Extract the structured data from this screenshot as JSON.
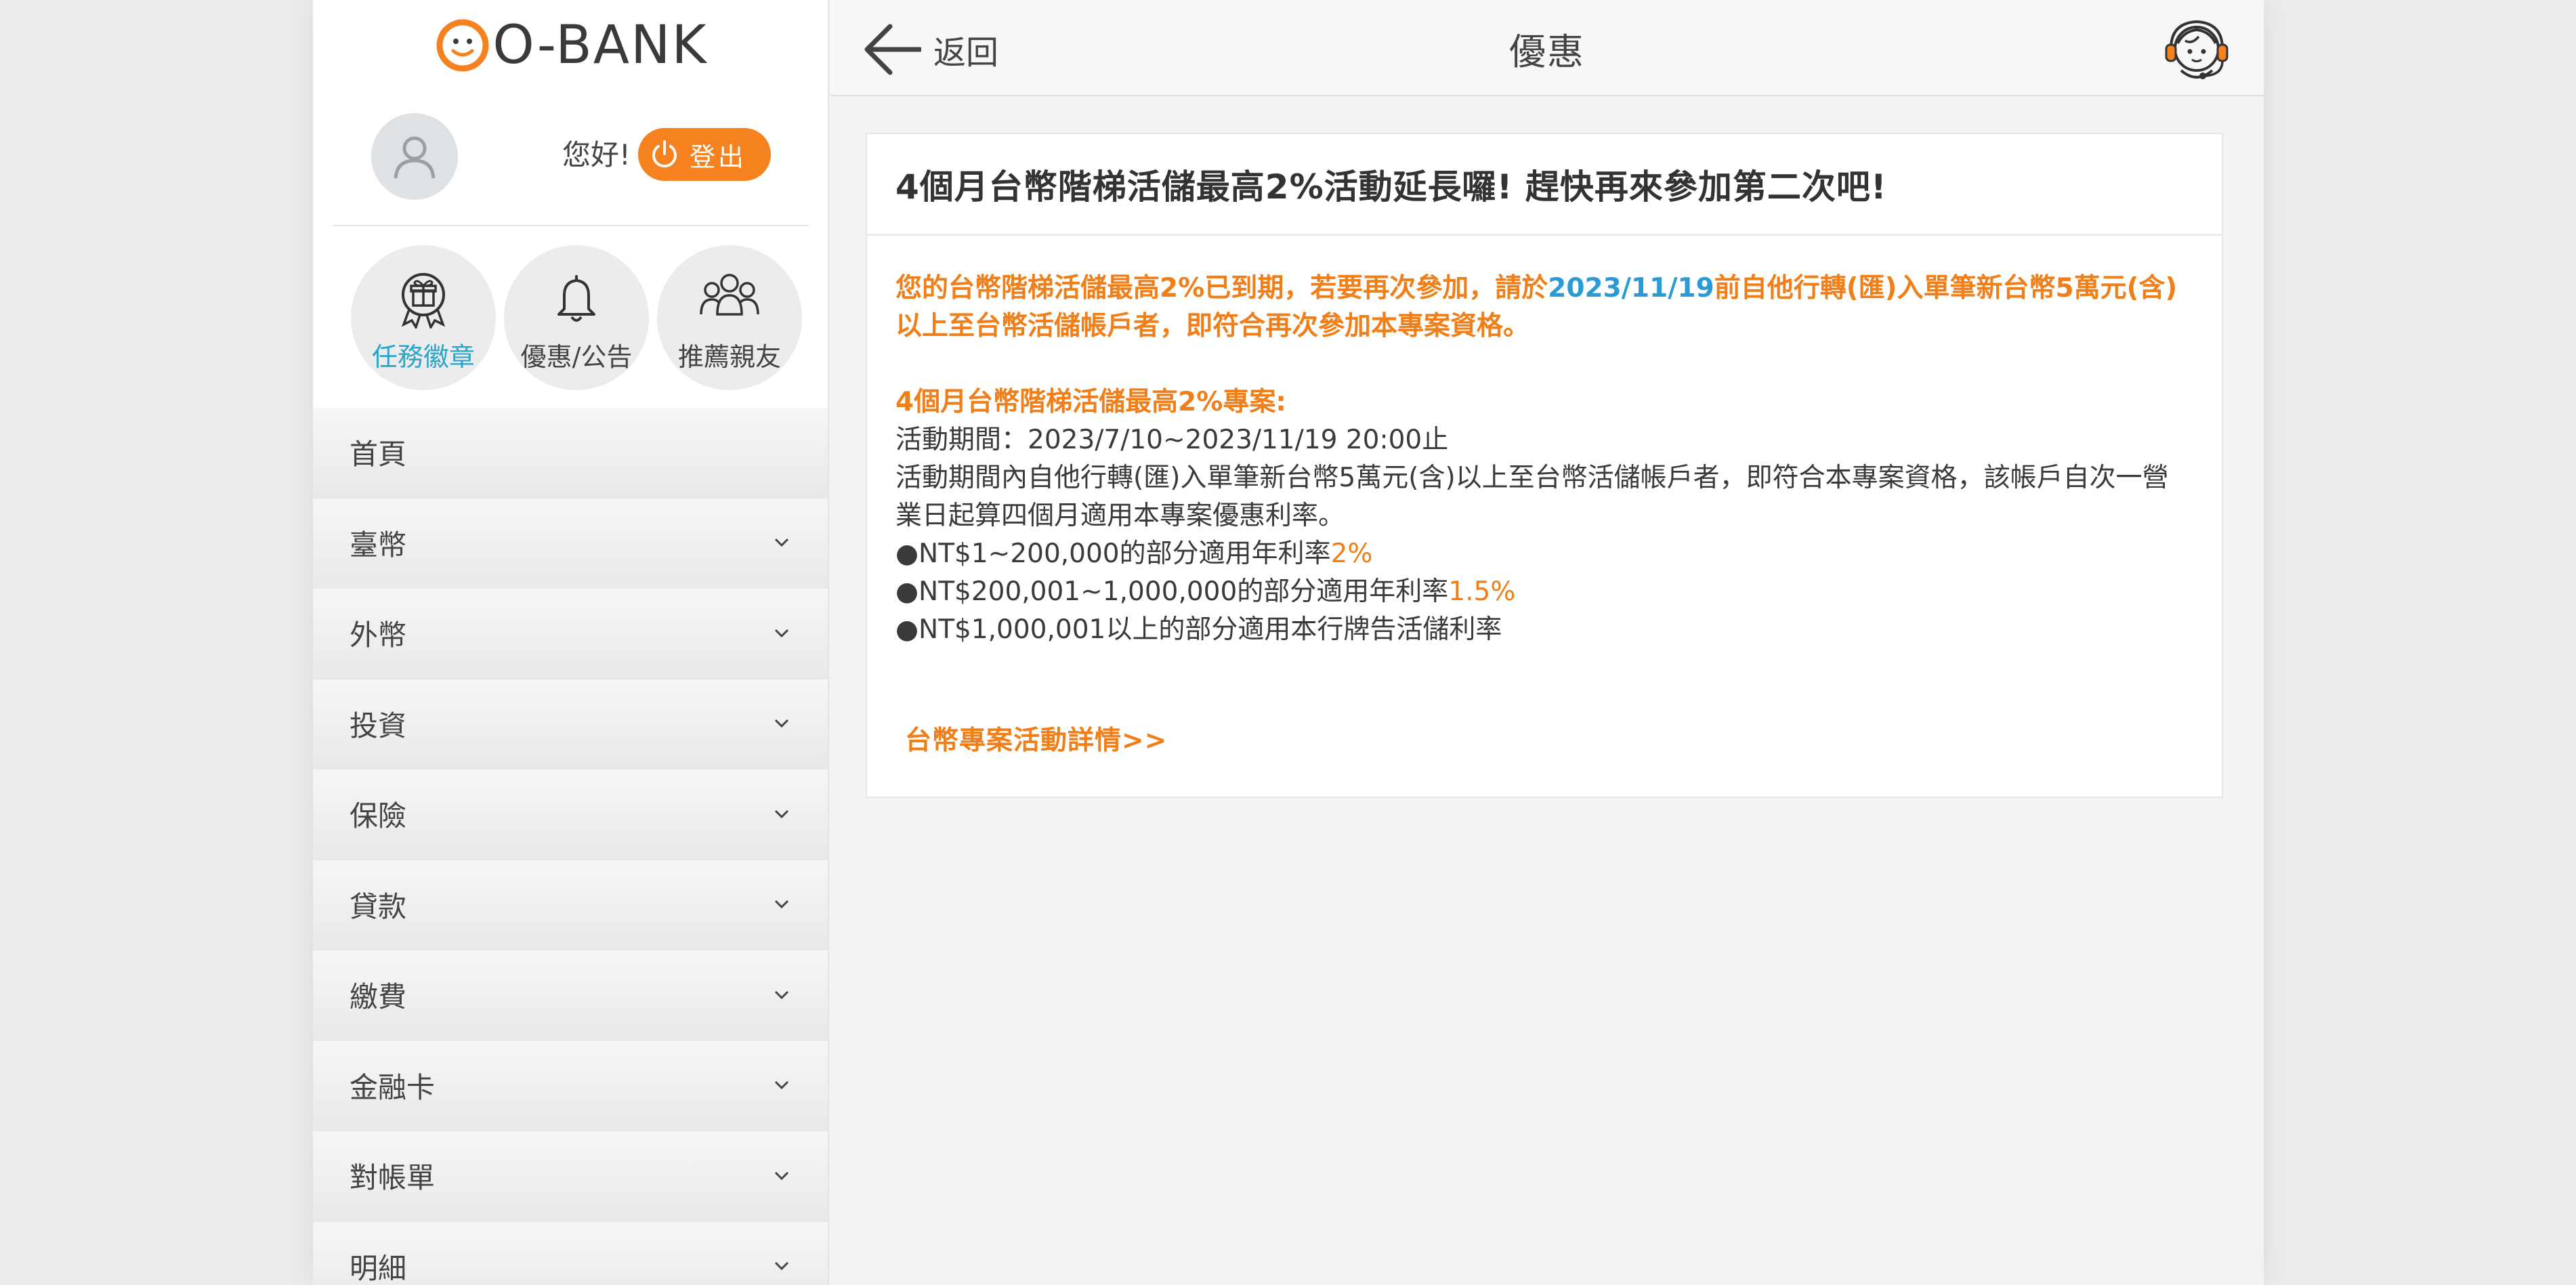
{
  "sidebar": {
    "logo": "O-BANK",
    "greeting": "您好!",
    "logout_label": "登出",
    "quick_links": [
      {
        "label": "任務徽章",
        "icon": "gift-badge-icon"
      },
      {
        "label": "優惠/公告",
        "icon": "bell-icon"
      },
      {
        "label": "推薦親友",
        "icon": "people-icon"
      }
    ],
    "menu": [
      {
        "label": "首頁"
      },
      {
        "label": "臺幣"
      },
      {
        "label": "外幣"
      },
      {
        "label": "投資"
      },
      {
        "label": "保險"
      },
      {
        "label": "貸款"
      },
      {
        "label": "繳費"
      },
      {
        "label": "金融卡"
      },
      {
        "label": "對帳單"
      },
      {
        "label": "明細"
      }
    ]
  },
  "header": {
    "back_label": "返回",
    "title": "優惠"
  },
  "article": {
    "title": "4個月台幣階梯活儲最高2%活動延長囉! 趕快再來參加第二次吧!",
    "notice_part1": "您的台幣階梯活儲最高2%已到期，若要再次參加，請於",
    "notice_date": "2023/11/19",
    "notice_part2": "前自他行轉(匯)入單筆新台幣5萬元(含)以上至台幣活儲帳戶者，即符合再次參加本專案資格。",
    "section_title": "4個月台幣階梯活儲最高2%專案:",
    "period": "活動期間：2023/7/10~2023/11/19 20:00止",
    "description": "活動期間內自他行轉(匯)入單筆新台幣5萬元(含)以上至台幣活儲帳戶者，即符合本專案資格，該帳戶自次一營業日起算四個月適用本專案優惠利率。",
    "tier1_text": "●NT$1~200,000的部分適用年利率",
    "tier1_rate": "2%",
    "tier2_text": "●NT$200,001~1,000,000的部分適用年利率",
    "tier2_rate": "1.5%",
    "tier3_text": "●NT$1,000,001以上的部分適用本行牌告活儲利率",
    "detail_link": "台幣專案活動詳情>>"
  },
  "colors": {
    "accent": "#f5821f",
    "link_blue": "#2a9bd6",
    "active_quick": "#2aa5c8"
  }
}
